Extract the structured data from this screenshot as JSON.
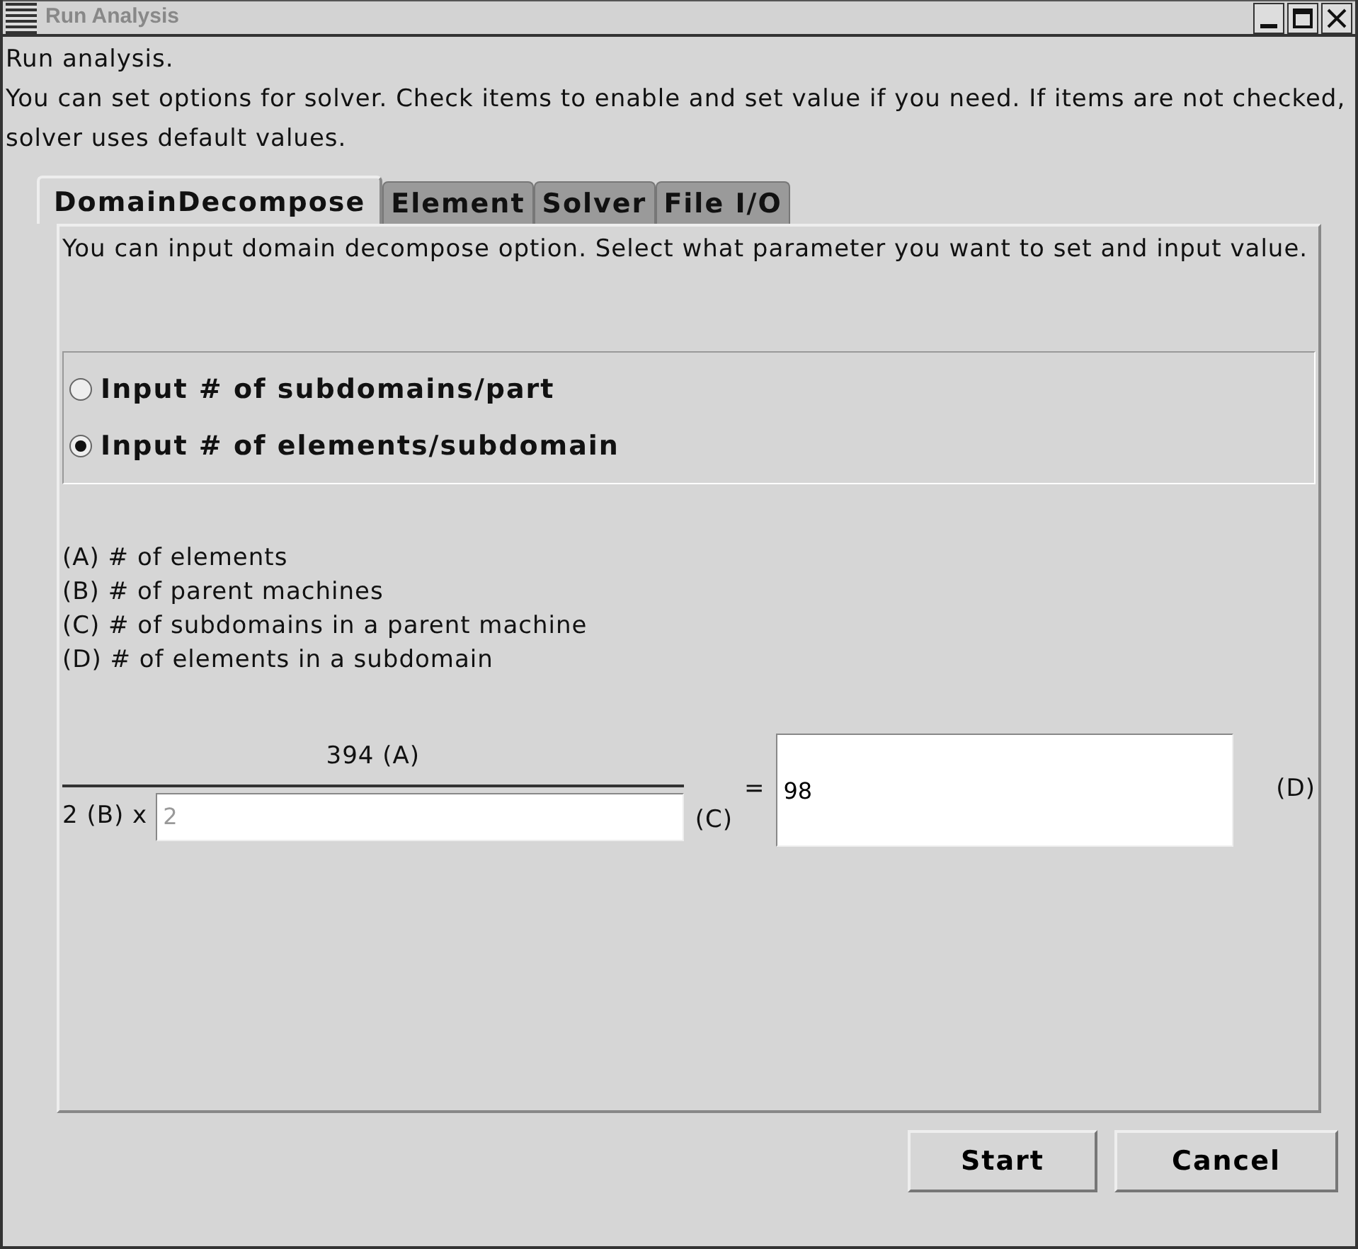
{
  "window": {
    "title": "Run Analysis"
  },
  "intro": [
    "Run analysis.",
    "You can set options for solver. Check items to enable and set value if you need. If items are not checked, solver uses default values."
  ],
  "tabs": [
    {
      "label": "DomainDecompose",
      "selected": true
    },
    {
      "label": "Element",
      "selected": false
    },
    {
      "label": "Solver",
      "selected": false
    },
    {
      "label": "File I/O",
      "selected": false
    }
  ],
  "panel": {
    "description": "You can input domain decompose option. Select what parameter you want to set and input value.",
    "options": [
      {
        "label": "Input # of subdomains/part",
        "selected": false
      },
      {
        "label": "Input # of elements/subdomain",
        "selected": true
      }
    ],
    "legend": [
      "(A) # of elements",
      "(B) # of parent machines",
      "(C) # of subdomains in a parent machine",
      "(D) # of elements in a subdomain"
    ],
    "formula": {
      "numerator": "394 (A)",
      "denominator_prefix": "2 (B) x",
      "subdomains_field": {
        "value": "2",
        "disabled": true
      },
      "subdomains_label": "(C)",
      "equals": "=",
      "result_field": {
        "value": "98",
        "disabled": false
      },
      "result_label": "(D)"
    }
  },
  "buttons": [
    "Start",
    "Cancel"
  ]
}
